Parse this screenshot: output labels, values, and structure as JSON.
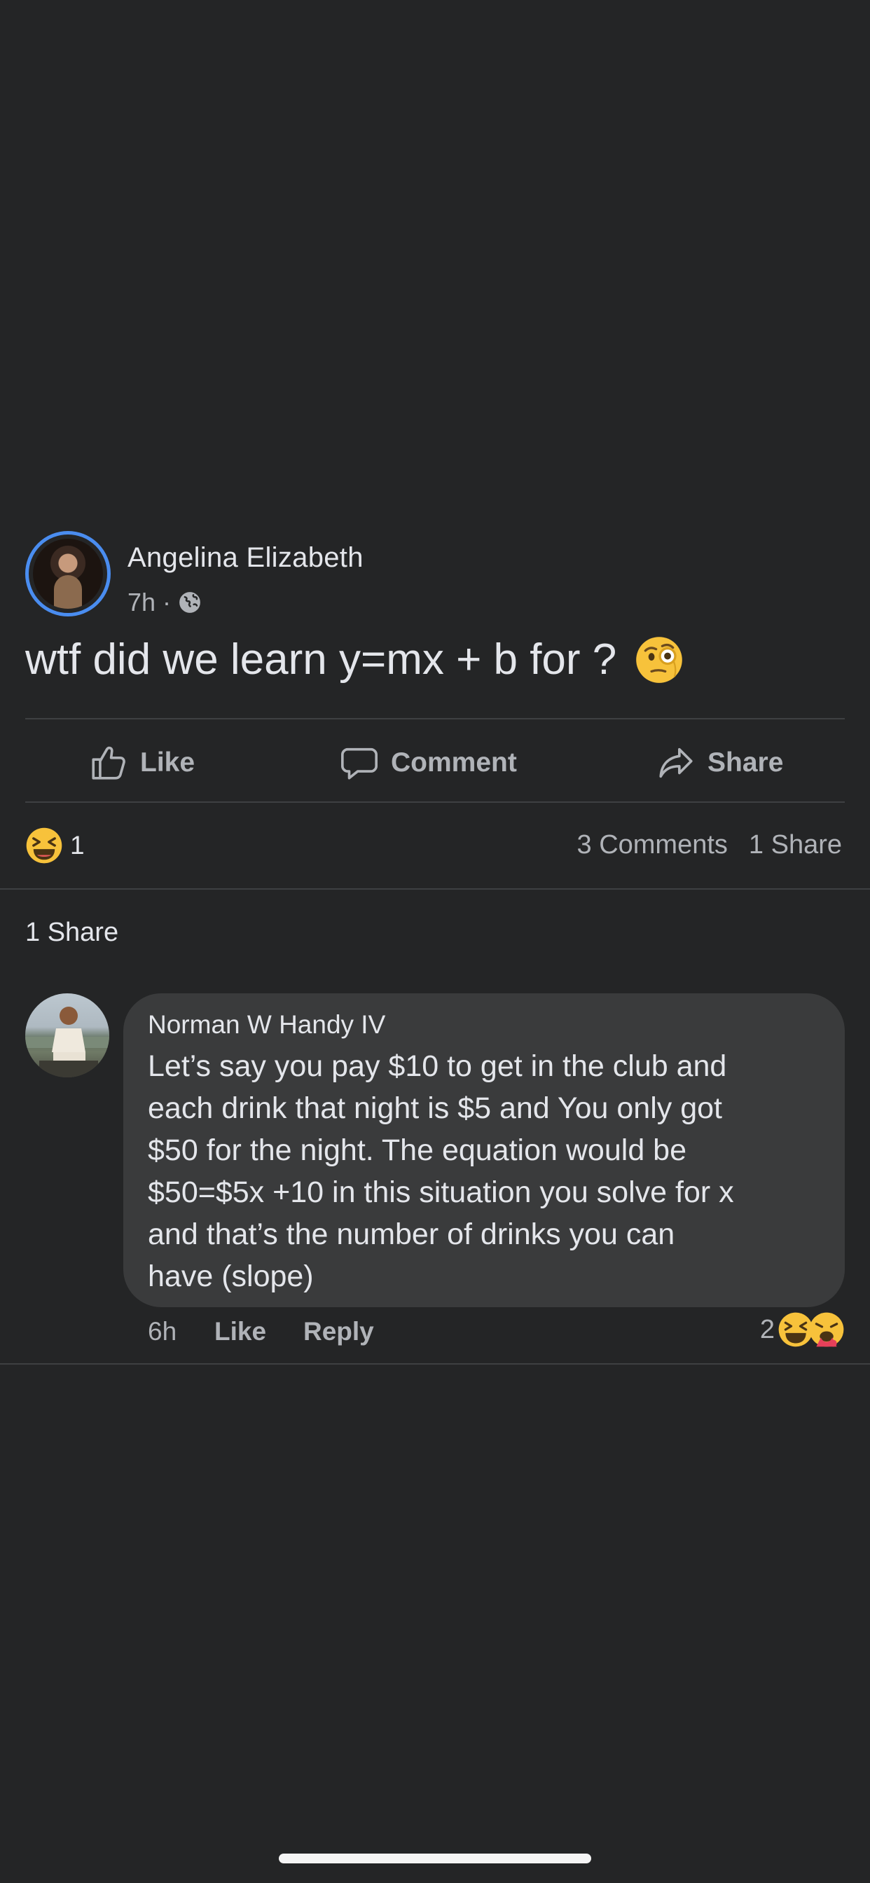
{
  "post": {
    "author": "Angelina Elizabeth",
    "time": "7h",
    "separator": "·",
    "privacy_icon": "globe-icon",
    "text": "wtf did we learn y=mx + b for ?",
    "emoji": "face-with-monocle-emoji"
  },
  "actions": {
    "like": "Like",
    "comment": "Comment",
    "share": "Share"
  },
  "summary": {
    "reaction_icon": "laughing-emoji",
    "reaction_count": "1",
    "comments": "3 Comments",
    "shares": "1 Share"
  },
  "shares_section": {
    "label": "1 Share"
  },
  "comment": {
    "author": "Norman W Handy IV",
    "text": "Let’s say you pay $10 to get in the club and\neach drink that night is $5 and You only got\n$50 for the night. The equation would be\n$50=$5x +10 in this situation you solve for x\nand that’s the number of drinks you can\nhave (slope)",
    "time": "6h",
    "like": "Like",
    "reply": "Reply",
    "reaction_count": "2",
    "reaction_icons": [
      "laughing-emoji",
      "face-vomiting-emoji"
    ]
  },
  "colors": {
    "background": "#242526",
    "bubble": "#3a3b3c",
    "primary_text": "#e4e6eb",
    "secondary_text": "#b0b3b8",
    "avatar_ring": "#4a8df0",
    "divider": "#3e4042"
  }
}
